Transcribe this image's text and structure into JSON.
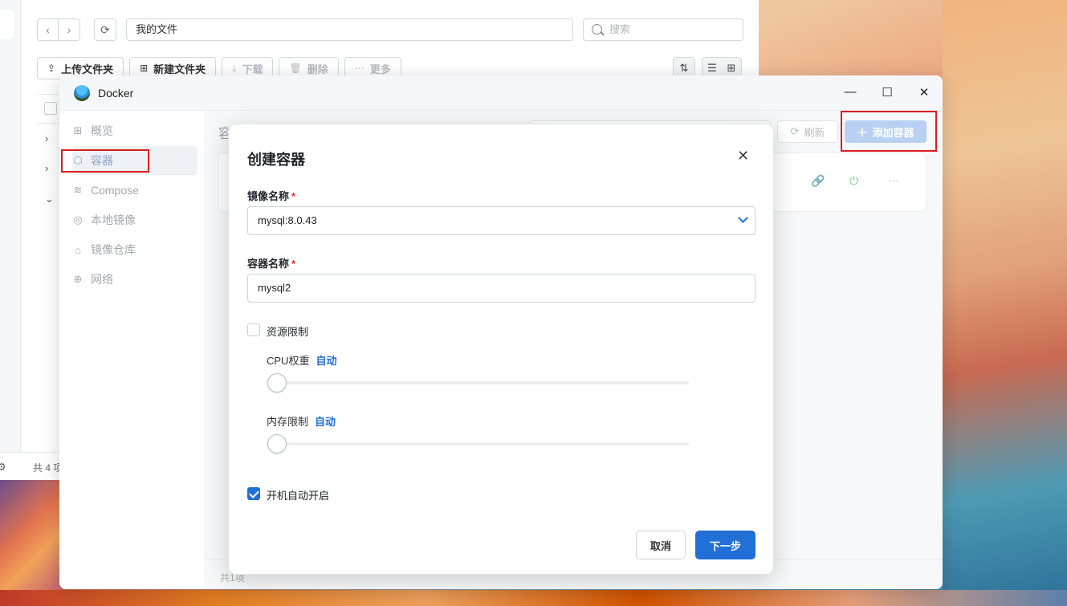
{
  "file_manager": {
    "nav_back": "‹",
    "nav_forward": "›",
    "refresh_icon": "⟳",
    "path": "我的文件",
    "search_placeholder": "搜索",
    "toolbar": {
      "upload": "上传文件夹",
      "new_folder": "新建文件夹",
      "download": "下载",
      "delete": "删除",
      "more": "更多"
    },
    "footer_count": "共 4 项"
  },
  "docker": {
    "title": "Docker",
    "window_controls": {
      "minimize": "—",
      "maximize": "☐",
      "close": "✕"
    },
    "sidebar": [
      {
        "icon": "grid-icon",
        "glyph": "⊞",
        "label": "概览"
      },
      {
        "icon": "box-icon",
        "glyph": "⬡",
        "label": "容器"
      },
      {
        "icon": "layers-icon",
        "glyph": "≋",
        "label": "Compose"
      },
      {
        "icon": "disk-icon",
        "glyph": "◎",
        "label": "本地镜像"
      },
      {
        "icon": "warehouse-icon",
        "glyph": "⌂",
        "label": "镜像仓库"
      },
      {
        "icon": "globe-icon",
        "glyph": "⊕",
        "label": "网络"
      }
    ],
    "main": {
      "heading": "容",
      "refresh_label": "刷新",
      "add_label": "添加容器",
      "footer": "共1项"
    }
  },
  "modal": {
    "title": "创建容器",
    "image_label": "镜像名称",
    "image_value": "mysql:8.0.43",
    "name_label": "容器名称",
    "name_value": "mysql2",
    "resource_limit_label": "资源限制",
    "resource_limit_checked": false,
    "cpu_label": "CPU权重",
    "cpu_value": "自动",
    "memory_label": "内存限制",
    "memory_value": "自动",
    "autostart_label": "开机自动开启",
    "autostart_checked": true,
    "cancel": "取消",
    "next": "下一步"
  },
  "colors": {
    "accent": "#1f6fd6",
    "required": "#e0303a",
    "highlight_box": "#d81e1e"
  }
}
